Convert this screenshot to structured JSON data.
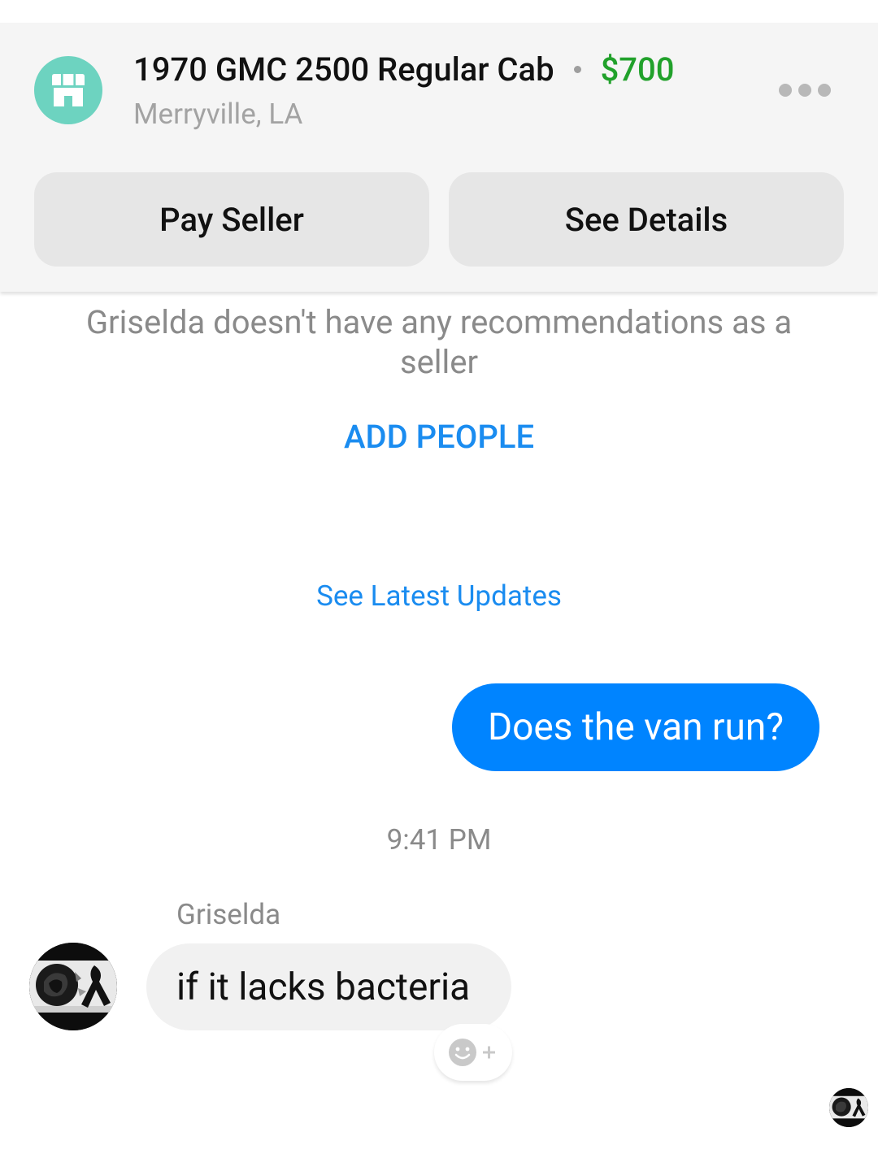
{
  "listing": {
    "title": "1970 GMC 2500 Regular Cab",
    "price": "$700",
    "location": "Merryville, LA",
    "shop_icon": "storefront-icon",
    "menu_icon": "more-horizontal-icon"
  },
  "actions": {
    "pay_seller": "Pay Seller",
    "see_details": "See Details"
  },
  "recommendations": {
    "text": "Griselda doesn't have any recommendations as a seller",
    "add_people": "ADD PEOPLE"
  },
  "conversation": {
    "latest_updates": "See Latest Updates",
    "messages": [
      {
        "direction": "outgoing",
        "text": "Does the van run?"
      },
      {
        "direction": "incoming",
        "sender": "Griselda",
        "text": "if it lacks bacteria"
      }
    ],
    "timestamp": "9:41 PM",
    "reaction_icon": "add-reaction-icon"
  },
  "colors": {
    "accent_blue": "#0084ff",
    "link_blue": "#1a8cf0",
    "price_green": "#21a12b",
    "shop_teal": "#6dd3c0",
    "header_bg": "#f5f5f5"
  }
}
